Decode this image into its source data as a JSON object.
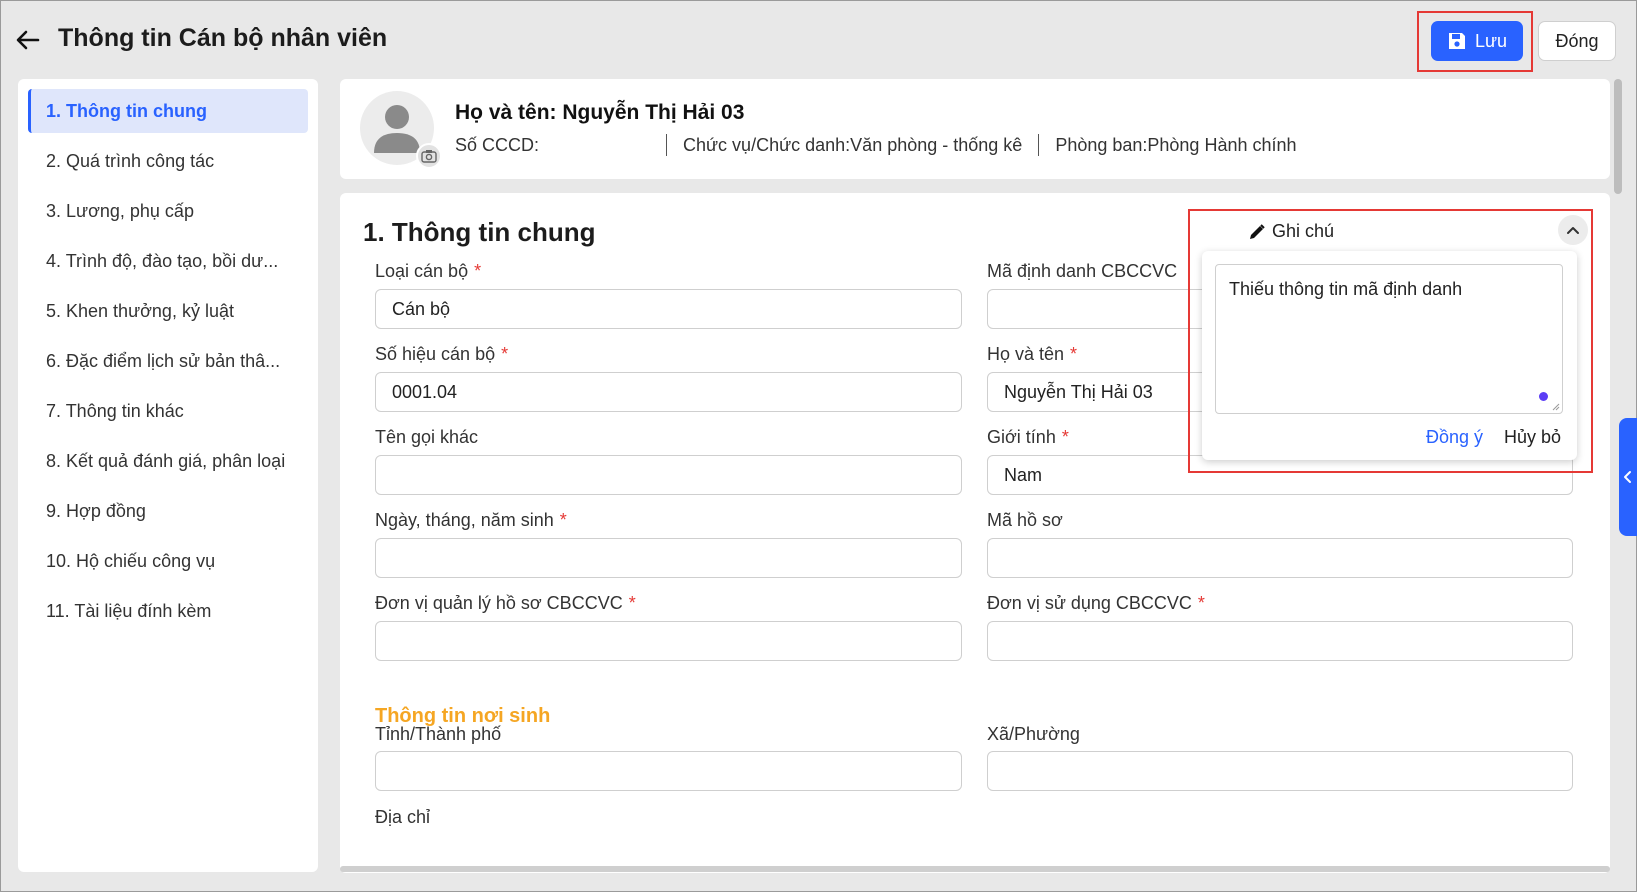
{
  "header": {
    "title": "Thông tin Cán bộ nhân viên",
    "save_label": "Lưu",
    "close_label": "Đóng"
  },
  "sidebar": {
    "items": [
      {
        "label": "1. Thông tin chung",
        "active": true
      },
      {
        "label": "2. Quá trình công tác"
      },
      {
        "label": "3. Lương, phụ cấp"
      },
      {
        "label": "4. Trình độ, đào tạo, bồi dư..."
      },
      {
        "label": "5. Khen thưởng, kỷ luật"
      },
      {
        "label": "6. Đặc điểm lịch sử bản thâ..."
      },
      {
        "label": "7. Thông tin khác"
      },
      {
        "label": "8. Kết quả đánh giá, phân loại"
      },
      {
        "label": "9. Hợp đồng"
      },
      {
        "label": "10. Hộ chiếu công vụ"
      },
      {
        "label": "11. Tài liệu đính kèm"
      }
    ]
  },
  "profile": {
    "name": "Họ và tên: Nguyễn Thị Hải 03",
    "cccd": "Số CCCD:",
    "position": "Chức vụ/Chức danh:Văn phòng - thống kê",
    "department": "Phòng ban:Phòng Hành chính"
  },
  "section": {
    "title": "1. Thông tin chung",
    "fields": {
      "loai_can_bo": {
        "label": "Loại cán bộ",
        "required": "*",
        "value": "Cán bộ"
      },
      "ma_dinh_danh": {
        "label": "Mã định danh CBCCVC",
        "value": ""
      },
      "so_hieu": {
        "label": "Số hiệu cán bộ",
        "required": "*",
        "value": "0001.04"
      },
      "ho_va_ten": {
        "label": "Họ và tên",
        "required": "*",
        "value": "Nguyễn Thị Hải 03"
      },
      "ten_goi_khac": {
        "label": "Tên gọi khác",
        "value": ""
      },
      "gioi_tinh": {
        "label": "Giới tính",
        "required": "*",
        "value": "Nam"
      },
      "ngay_sinh": {
        "label": "Ngày, tháng, năm sinh",
        "required": "*",
        "value": ""
      },
      "ma_ho_so": {
        "label": "Mã hồ sơ",
        "value": ""
      },
      "don_vi_quan_ly": {
        "label": "Đơn vị quản lý hồ sơ CBCCVC",
        "required": "*",
        "value": ""
      },
      "don_vi_su_dung": {
        "label": "Đơn vị sử dụng CBCCVC",
        "required": "*",
        "value": ""
      },
      "tinh": {
        "label": "Tỉnh/Thành phố",
        "value": ""
      },
      "xa": {
        "label": "Xã/Phường",
        "value": ""
      },
      "dia_chi": {
        "label": "Địa chỉ"
      }
    },
    "subsection_birthplace": "Thông tin nơi sinh"
  },
  "note": {
    "title": "Ghi chú",
    "text": "Thiếu thông tin mã định danh",
    "confirm_label": "Đồng ý",
    "cancel_label": "Hủy bỏ"
  },
  "colors": {
    "accent": "#2962ff",
    "required": "#e53935",
    "subsection": "#f5a623",
    "highlight_border": "#e53935"
  }
}
